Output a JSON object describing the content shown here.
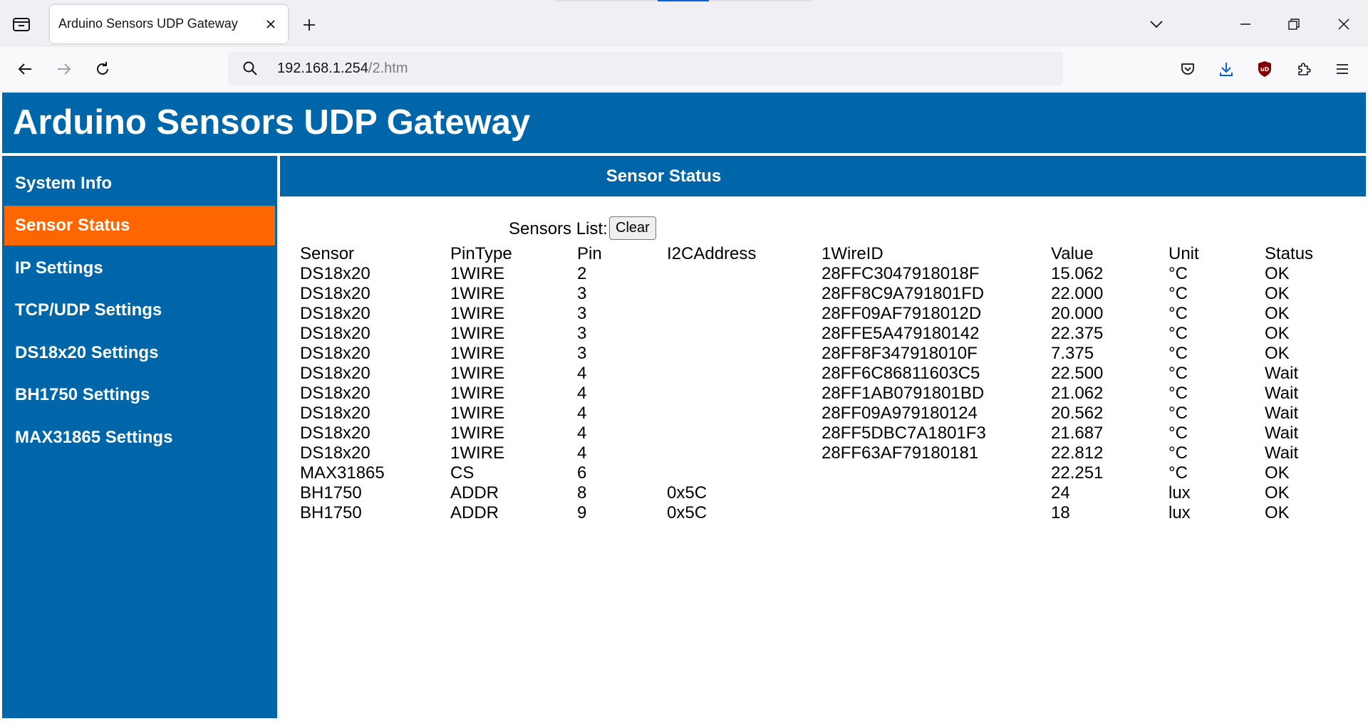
{
  "browser": {
    "tab_title": "Arduino Sensors UDP Gateway",
    "url_host": "192.168.1.254",
    "url_path": "/2.htm",
    "icons": {
      "tab_list": "tab-list-icon",
      "close_tab": "close-icon",
      "new_tab": "plus-icon",
      "list_all_tabs": "chevron-down-icon",
      "minimize": "minimize-icon",
      "restore": "restore-icon",
      "close_window": "close-icon",
      "back": "back-arrow-icon",
      "forward": "forward-arrow-icon",
      "reload": "reload-icon",
      "search": "search-icon",
      "pocket": "pocket-icon",
      "downloads": "download-icon",
      "ublock": "ublock-shield-icon",
      "extensions": "puzzle-icon",
      "menu": "hamburger-menu-icon"
    },
    "accent_color": "#0060df",
    "ublock_color": "#800000"
  },
  "page": {
    "title": "Arduino Sensors UDP Gateway",
    "header_color": "#0066aa",
    "active_color": "#ff6600"
  },
  "sidebar": {
    "items": [
      {
        "label": "System Info",
        "active": false
      },
      {
        "label": "Sensor Status",
        "active": true
      },
      {
        "label": "IP Settings",
        "active": false
      },
      {
        "label": "TCP/UDP Settings",
        "active": false
      },
      {
        "label": "DS18x20 Settings",
        "active": false
      },
      {
        "label": "BH1750 Settings",
        "active": false
      },
      {
        "label": "MAX31865 Settings",
        "active": false
      }
    ]
  },
  "main": {
    "section_title": "Sensor Status",
    "list_label": "Sensors List:",
    "clear_button": "Clear",
    "columns": [
      "Sensor",
      "PinType",
      "Pin",
      "I2CAddress",
      "1WireID",
      "Value",
      "Unit",
      "Status"
    ],
    "rows": [
      [
        "DS18x20",
        "1WIRE",
        "2",
        "",
        "28FFC3047918018F",
        "15.062",
        "°C",
        "OK"
      ],
      [
        "DS18x20",
        "1WIRE",
        "3",
        "",
        "28FF8C9A791801FD",
        "22.000",
        "°C",
        "OK"
      ],
      [
        "DS18x20",
        "1WIRE",
        "3",
        "",
        "28FF09AF7918012D",
        "20.000",
        "°C",
        "OK"
      ],
      [
        "DS18x20",
        "1WIRE",
        "3",
        "",
        "28FFE5A479180142",
        "22.375",
        "°C",
        "OK"
      ],
      [
        "DS18x20",
        "1WIRE",
        "3",
        "",
        "28FF8F347918010F",
        "7.375",
        "°C",
        "OK"
      ],
      [
        "DS18x20",
        "1WIRE",
        "4",
        "",
        "28FF6C86811603C5",
        "22.500",
        "°C",
        "Wait"
      ],
      [
        "DS18x20",
        "1WIRE",
        "4",
        "",
        "28FF1AB0791801BD",
        "21.062",
        "°C",
        "Wait"
      ],
      [
        "DS18x20",
        "1WIRE",
        "4",
        "",
        "28FF09A979180124",
        "20.562",
        "°C",
        "Wait"
      ],
      [
        "DS18x20",
        "1WIRE",
        "4",
        "",
        "28FF5DBC7A1801F3",
        "21.687",
        "°C",
        "Wait"
      ],
      [
        "DS18x20",
        "1WIRE",
        "4",
        "",
        "28FF63AF79180181",
        "22.812",
        "°C",
        "Wait"
      ],
      [
        "MAX31865",
        "CS",
        "6",
        "",
        "",
        "22.251",
        "°C",
        "OK"
      ],
      [
        "BH1750",
        "ADDR",
        "8",
        "0x5C",
        "",
        "24",
        "lux",
        "OK"
      ],
      [
        "BH1750",
        "ADDR",
        "9",
        "0x5C",
        "",
        "18",
        "lux",
        "OK"
      ]
    ]
  }
}
